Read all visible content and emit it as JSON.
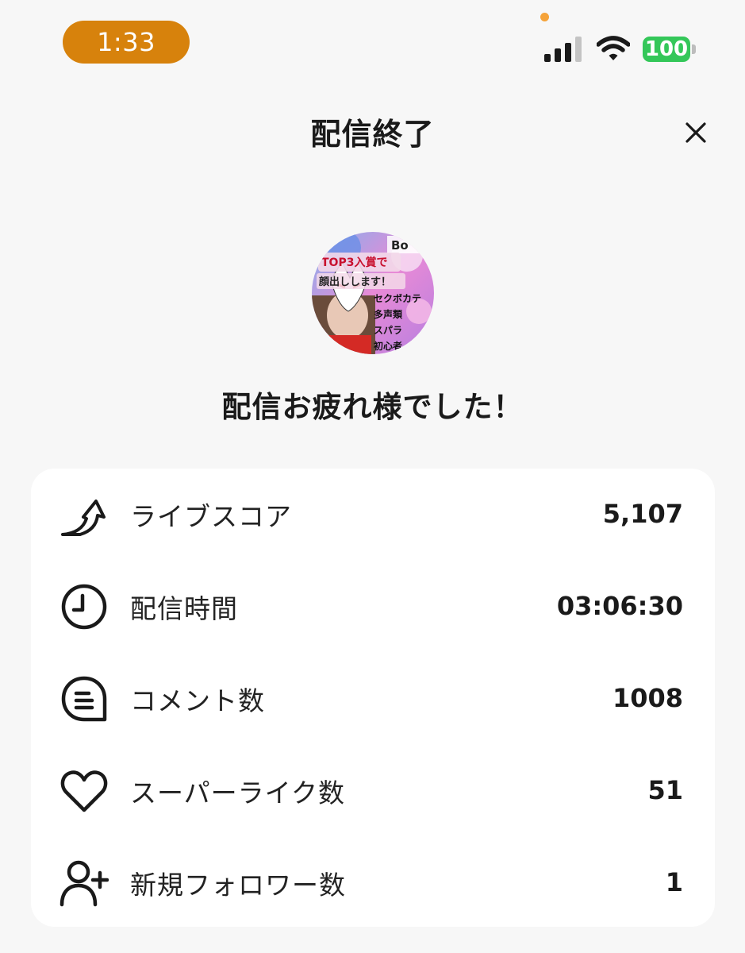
{
  "status_bar": {
    "time": "1:33",
    "battery": "100",
    "accent_color": "#d7820c",
    "battery_color": "#34c759",
    "privacy_dot_color": "#f5a33a",
    "icons": [
      "signal-icon",
      "wifi-icon",
      "battery-icon"
    ]
  },
  "header": {
    "title": "配信終了",
    "close_icon": "close-icon"
  },
  "avatar": {
    "banner_text": "TOP3入賞で",
    "banner_text_2": "顔出しします！",
    "side_text": [
      "セクボカテ",
      "多声類",
      "スパラ",
      "初心者"
    ],
    "corner_text": "Bo"
  },
  "message": "配信お疲れ様でした！",
  "stats": [
    {
      "icon": "arrow-up-icon",
      "label": "ライブスコア",
      "value": "5,107"
    },
    {
      "icon": "clock-icon",
      "label": "配信時間",
      "value": "03:06:30"
    },
    {
      "icon": "comment-icon",
      "label": "コメント数",
      "value": "1008"
    },
    {
      "icon": "heart-icon",
      "label": "スーパーライク数",
      "value": "51"
    },
    {
      "icon": "user-plus-icon",
      "label": "新規フォロワー数",
      "value": "1"
    }
  ]
}
